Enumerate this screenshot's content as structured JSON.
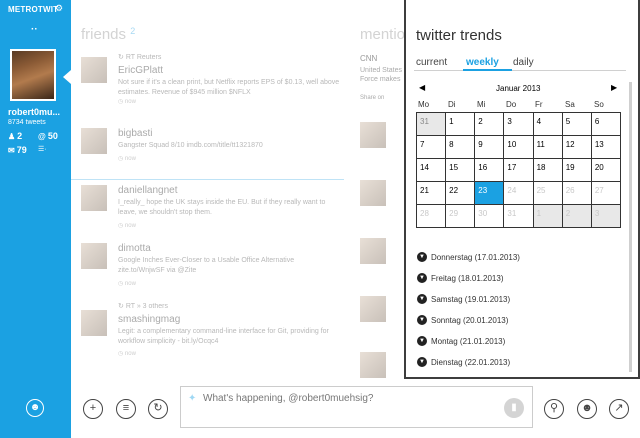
{
  "app": {
    "title": "METROTWIT"
  },
  "profile": {
    "username": "robert0mu...",
    "tweets": "8734 tweets",
    "following": "2",
    "mentions": "50",
    "messages": "79"
  },
  "friends": {
    "title": "friends",
    "count": "2",
    "tweets": [
      {
        "meta": "RT Reuters",
        "name": "EricGPlatt",
        "text": "Not sure if it's a clean print, but Netflix reports EPS of $0.13, well above estimates. Revenue of $945 million $NFLX",
        "time": "now"
      },
      {
        "name": "bigbasti",
        "text": "Gangster Squad 8/10 imdb.com/title/tt1321870",
        "time": "now"
      },
      {
        "name": "daniellangnet",
        "text": "I_really_ hope the UK stays inside the EU. But if they really want to leave, we shouldn't stop them.",
        "time": "now"
      },
      {
        "name": "dimotta",
        "text": "Google Inches Ever-Closer to a Usable Office Alternative zite.to/WnjwSF via @Zite",
        "time": "now"
      },
      {
        "meta": "RT » 3 others",
        "name": "smashingmag",
        "text": "Legit: a complementary command-line interface for Git, providing for workflow simplicity - bit.ly/Ocqc4",
        "time": "now"
      }
    ]
  },
  "mentions": {
    "title": "mentio",
    "preview_name": "CNN",
    "preview_text": "United States Force makes",
    "preview_share": "Share on"
  },
  "compose": {
    "placeholder": "What's happening, @robert0muehsig?"
  },
  "trends": {
    "title": "twitter trends",
    "tabs": [
      "current",
      "weekly",
      "daily"
    ],
    "active_tab": "weekly",
    "month": "Januar 2013",
    "weekdays": [
      "Mo",
      "Di",
      "Mi",
      "Do",
      "Fr",
      "Sa",
      "So"
    ],
    "weeks": [
      [
        "31",
        "1",
        "2",
        "3",
        "4",
        "5",
        "6"
      ],
      [
        "7",
        "8",
        "9",
        "10",
        "11",
        "12",
        "13"
      ],
      [
        "14",
        "15",
        "16",
        "17",
        "18",
        "19",
        "20"
      ],
      [
        "21",
        "22",
        "23",
        "24",
        "25",
        "26",
        "27"
      ],
      [
        "28",
        "29",
        "30",
        "31",
        "1",
        "2",
        "3"
      ]
    ],
    "selected_day": "23",
    "days": [
      "Donnerstag (17.01.2013)",
      "Freitag (18.01.2013)",
      "Samstag (19.01.2013)",
      "Sonntag (20.01.2013)",
      "Montag (21.01.2013)",
      "Dienstag (22.01.2013)"
    ]
  },
  "colors": {
    "accent": "#1ba1e2",
    "popup_border": "#3d3d3d",
    "other_month": "#e8e8e8"
  }
}
